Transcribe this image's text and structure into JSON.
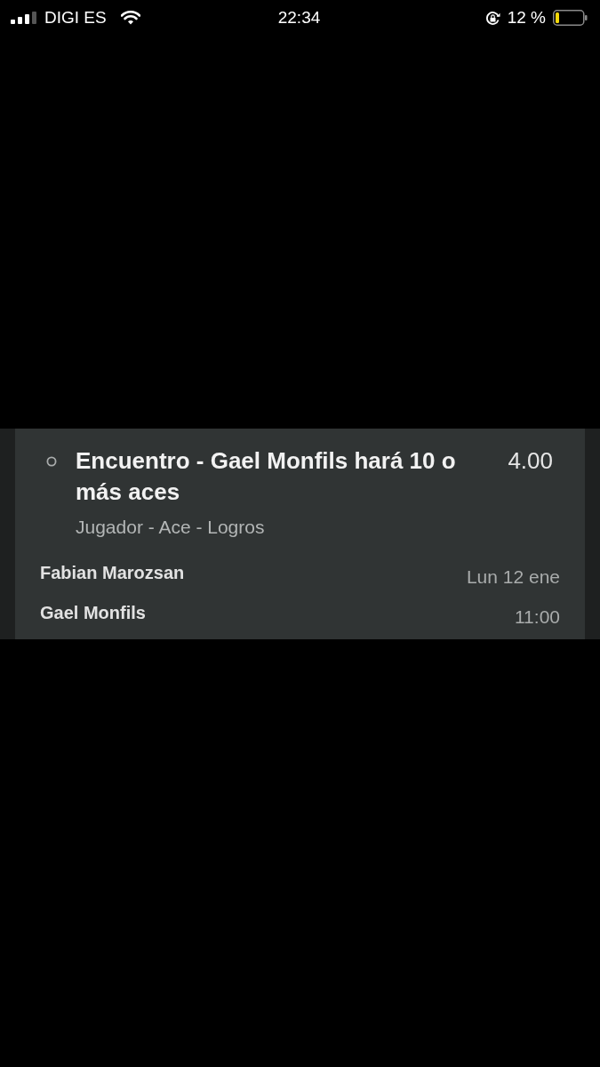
{
  "status_bar": {
    "carrier": "DIGI ES",
    "time": "22:34",
    "battery": "12 %"
  },
  "bet": {
    "title": "Encuentro - Gael Monfils hará 10 o más aces",
    "odds": "4.00",
    "market": "Jugador - Ace - Logros"
  },
  "event_rows": [
    {
      "player": "Fabian Marozsan",
      "info": "Lun 12 ene"
    },
    {
      "player": "Gael Monfils",
      "info": "11:00"
    }
  ]
}
